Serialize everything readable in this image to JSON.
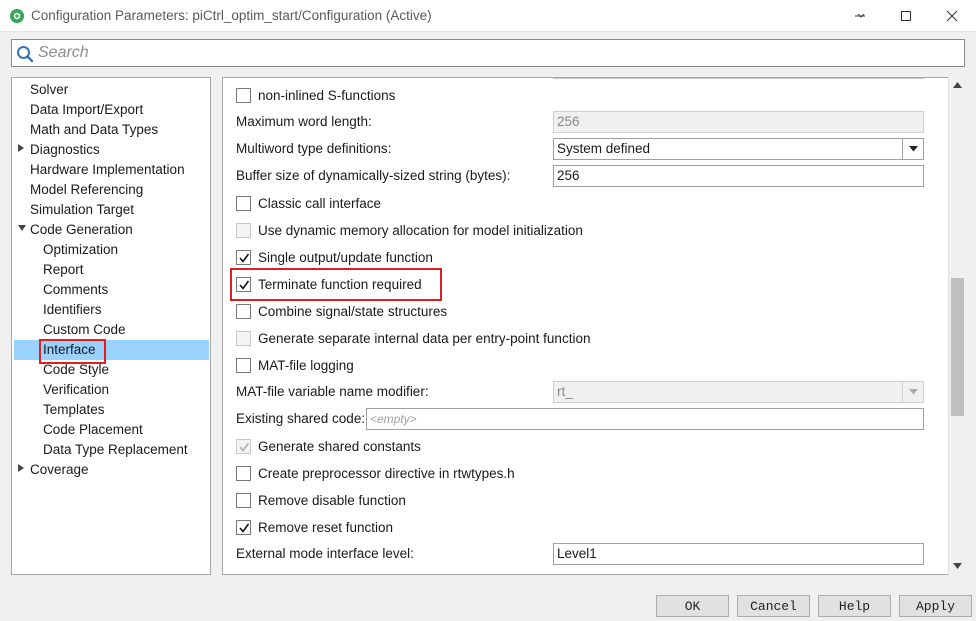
{
  "window": {
    "title": "Configuration Parameters: piCtrl_optim_start/Configuration (Active)"
  },
  "search": {
    "placeholder": "Search"
  },
  "tree": {
    "items": [
      {
        "label": "Solver",
        "level": 0,
        "expander": ""
      },
      {
        "label": "Data Import/Export",
        "level": 0,
        "expander": ""
      },
      {
        "label": "Math and Data Types",
        "level": 0,
        "expander": ""
      },
      {
        "label": "Diagnostics",
        "level": 0,
        "expander": "collapsed"
      },
      {
        "label": "Hardware Implementation",
        "level": 0,
        "expander": ""
      },
      {
        "label": "Model Referencing",
        "level": 0,
        "expander": ""
      },
      {
        "label": "Simulation Target",
        "level": 0,
        "expander": ""
      },
      {
        "label": "Code Generation",
        "level": 0,
        "expander": "expanded"
      },
      {
        "label": "Optimization",
        "level": 1,
        "expander": ""
      },
      {
        "label": "Report",
        "level": 1,
        "expander": ""
      },
      {
        "label": "Comments",
        "level": 1,
        "expander": ""
      },
      {
        "label": "Identifiers",
        "level": 1,
        "expander": ""
      },
      {
        "label": "Custom Code",
        "level": 1,
        "expander": ""
      },
      {
        "label": "Interface",
        "level": 1,
        "expander": "",
        "selected": true
      },
      {
        "label": "Code Style",
        "level": 1,
        "expander": ""
      },
      {
        "label": "Verification",
        "level": 1,
        "expander": ""
      },
      {
        "label": "Templates",
        "level": 1,
        "expander": ""
      },
      {
        "label": "Code Placement",
        "level": 1,
        "expander": ""
      },
      {
        "label": "Data Type Replacement",
        "level": 1,
        "expander": ""
      },
      {
        "label": "Coverage",
        "level": 0,
        "expander": "collapsed"
      }
    ]
  },
  "settings": {
    "non_inlined": {
      "label": "non-inlined S-functions",
      "checked": false,
      "enabled": true
    },
    "max_word_length": {
      "label": "Maximum word length:",
      "value": "256",
      "enabled": false
    },
    "multiword_type": {
      "label": "Multiword type definitions:",
      "value": "System defined"
    },
    "buffer_size": {
      "label": "Buffer size of dynamically-sized string (bytes):",
      "value": "256"
    },
    "classic_call": {
      "label": "Classic call interface",
      "checked": false,
      "enabled": true
    },
    "dynamic_memory": {
      "label": "Use dynamic memory allocation for model initialization",
      "checked": false,
      "enabled": false
    },
    "single_output": {
      "label": "Single output/update function",
      "checked": true,
      "enabled": true
    },
    "terminate_fn": {
      "label": "Terminate function required",
      "checked": true,
      "enabled": true
    },
    "combine_signal": {
      "label": "Combine signal/state structures",
      "checked": false,
      "enabled": true
    },
    "separate_internal": {
      "label": "Generate separate internal data per entry-point function",
      "checked": false,
      "enabled": false
    },
    "mat_logging": {
      "label": "MAT-file logging",
      "checked": false,
      "enabled": true
    },
    "mat_modifier": {
      "label": "MAT-file variable name modifier:",
      "value": "rt_",
      "enabled": false
    },
    "existing_shared": {
      "label": "Existing shared code:",
      "placeholder": "<empty>"
    },
    "shared_constants": {
      "label": "Generate shared constants",
      "checked": true,
      "enabled": false
    },
    "preprocessor": {
      "label": "Create preprocessor directive in rtwtypes.h",
      "checked": false,
      "enabled": true
    },
    "remove_disable": {
      "label": "Remove disable function",
      "checked": false,
      "enabled": true
    },
    "remove_reset": {
      "label": "Remove reset function",
      "checked": true,
      "enabled": true
    },
    "ext_mode_level": {
      "label": "External mode interface level:",
      "value": "Level1"
    }
  },
  "buttons": {
    "ok": "OK",
    "cancel": "Cancel",
    "help": "Help",
    "apply": "Apply"
  },
  "colors": {
    "selection": "#99d1ff",
    "highlight_box": "#e02020"
  }
}
